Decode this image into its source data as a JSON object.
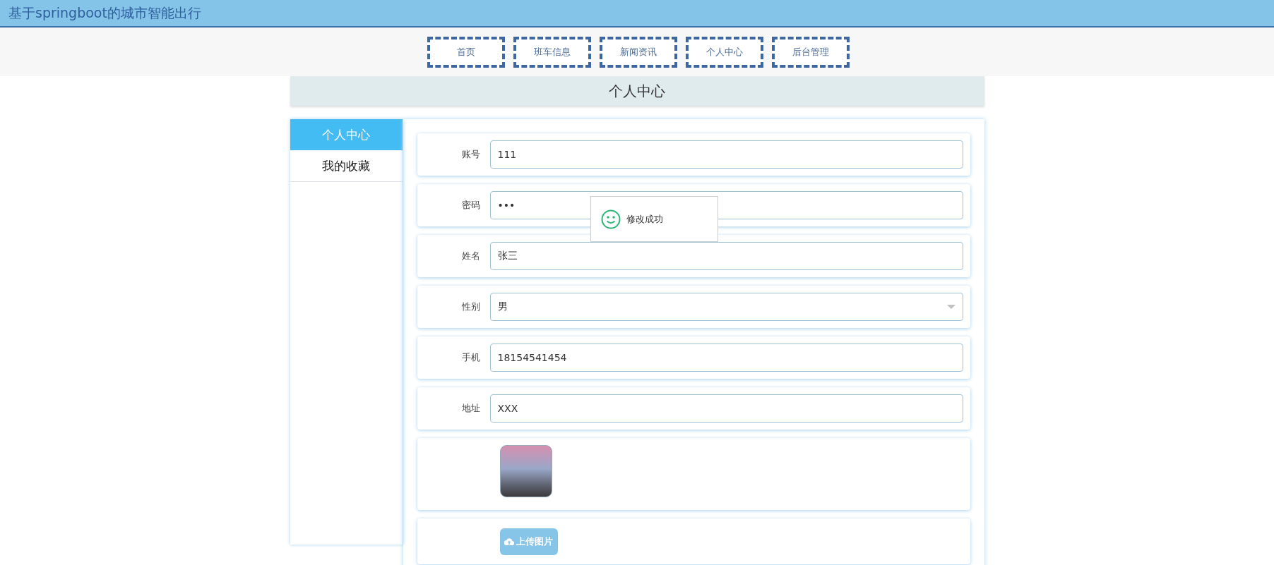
{
  "header": {
    "title": "基于springboot的城市智能出行"
  },
  "nav": [
    {
      "label": "首页"
    },
    {
      "label": "班车信息"
    },
    {
      "label": "新闻资讯"
    },
    {
      "label": "个人中心"
    },
    {
      "label": "后台管理"
    }
  ],
  "page_title": "个人中心",
  "sidebar": {
    "items": [
      {
        "label": "个人中心",
        "selected": true
      },
      {
        "label": "我的收藏",
        "selected": false
      }
    ]
  },
  "form": {
    "fields": [
      {
        "kind": "text",
        "label": "账号",
        "value": "111"
      },
      {
        "kind": "text",
        "label": "密码",
        "value": "•••"
      },
      {
        "kind": "text",
        "label": "姓名",
        "value": "张三"
      },
      {
        "kind": "select",
        "label": "性别",
        "value": "男"
      },
      {
        "kind": "text",
        "label": "手机",
        "value": "18154541454"
      },
      {
        "kind": "text",
        "label": "地址",
        "value": "XXX"
      },
      {
        "kind": "photo"
      },
      {
        "kind": "upload",
        "button": "上传图片"
      }
    ]
  },
  "toast": {
    "message": "修改成功"
  }
}
